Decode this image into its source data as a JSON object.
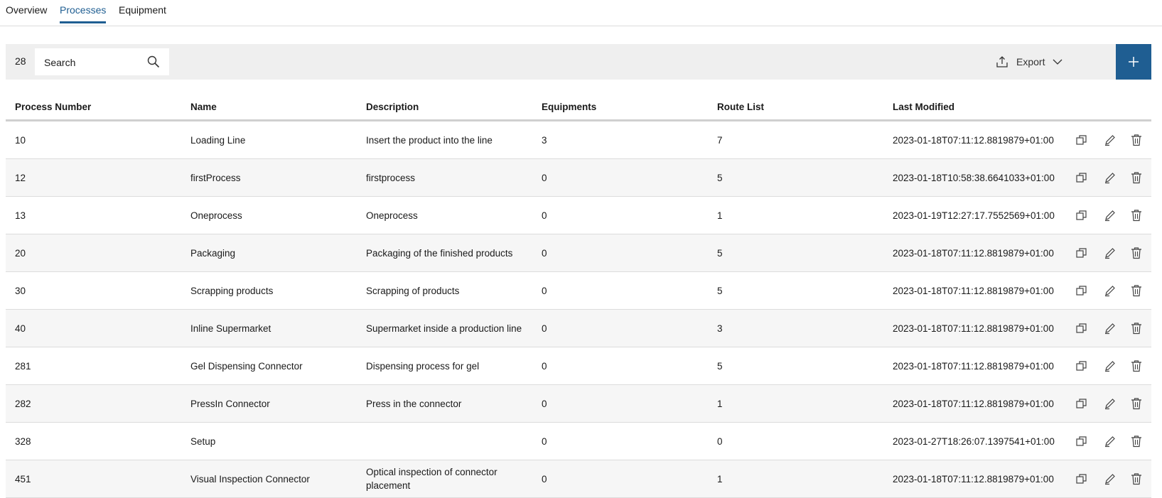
{
  "tabs": [
    {
      "label": "Overview"
    },
    {
      "label": "Processes"
    },
    {
      "label": "Equipment"
    }
  ],
  "toolbar": {
    "count": "28",
    "search_placeholder": "Search",
    "export_label": "Export"
  },
  "table": {
    "headers": [
      "Process Number",
      "Name",
      "Description",
      "Equipments",
      "Route List",
      "Last Modified"
    ],
    "rows": [
      {
        "number": "10",
        "name": "Loading Line",
        "description": "Insert the product into the line",
        "equipments": "3",
        "route_list": "7",
        "last_modified": "2023-01-18T07:11:12.8819879+01:00"
      },
      {
        "number": "12",
        "name": "firstProcess",
        "description": "firstprocess",
        "equipments": "0",
        "route_list": "5",
        "last_modified": "2023-01-18T10:58:38.6641033+01:00"
      },
      {
        "number": "13",
        "name": "Oneprocess",
        "description": "Oneprocess",
        "equipments": "0",
        "route_list": "1",
        "last_modified": "2023-01-19T12:27:17.7552569+01:00"
      },
      {
        "number": "20",
        "name": "Packaging",
        "description": "Packaging of the finished products",
        "equipments": "0",
        "route_list": "5",
        "last_modified": "2023-01-18T07:11:12.8819879+01:00"
      },
      {
        "number": "30",
        "name": "Scrapping products",
        "description": "Scrapping of products",
        "equipments": "0",
        "route_list": "5",
        "last_modified": "2023-01-18T07:11:12.8819879+01:00"
      },
      {
        "number": "40",
        "name": "Inline Supermarket",
        "description": "Supermarket inside a production line",
        "equipments": "0",
        "route_list": "3",
        "last_modified": "2023-01-18T07:11:12.8819879+01:00"
      },
      {
        "number": "281",
        "name": "Gel Dispensing Connector",
        "description": "Dispensing process for gel",
        "equipments": "0",
        "route_list": "5",
        "last_modified": "2023-01-18T07:11:12.8819879+01:00"
      },
      {
        "number": "282",
        "name": "PressIn Connector",
        "description": "Press in the connector",
        "equipments": "0",
        "route_list": "1",
        "last_modified": "2023-01-18T07:11:12.8819879+01:00"
      },
      {
        "number": "328",
        "name": "Setup",
        "description": "",
        "equipments": "0",
        "route_list": "0",
        "last_modified": "2023-01-27T18:26:07.1397541+01:00"
      },
      {
        "number": "451",
        "name": "Visual Inspection Connector",
        "description": "Optical inspection of connector placement",
        "equipments": "0",
        "route_list": "1",
        "last_modified": "2023-01-18T07:11:12.8819879+01:00"
      }
    ],
    "row_action_icons": [
      "copy-icon",
      "edit-icon",
      "delete-icon"
    ]
  },
  "colors": {
    "accent": "#1f5e92",
    "toolbar_bg": "#efefef",
    "alt_row": "#f6f6f6"
  }
}
